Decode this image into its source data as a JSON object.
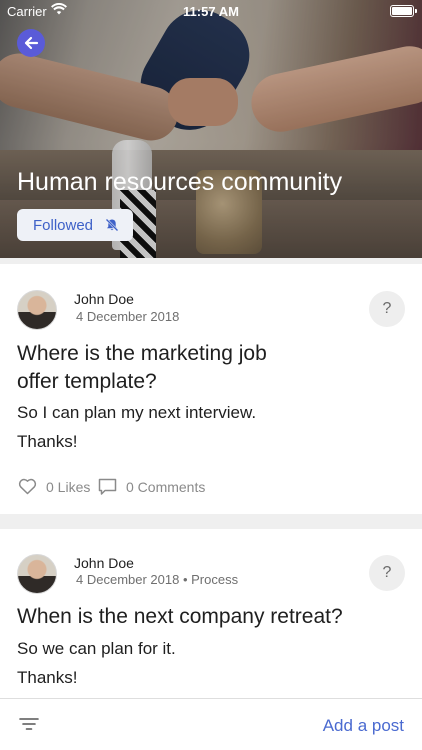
{
  "status_bar": {
    "carrier": "Carrier",
    "time": "11:57 AM"
  },
  "header": {
    "title": "Human resources community",
    "follow_label": "Followed",
    "icons": {
      "back": "arrow-left-icon",
      "bell": "bell-off-icon"
    },
    "accent_color": "#5a5bd8"
  },
  "posts": [
    {
      "author": "John Doe",
      "meta": "4 December 2018",
      "question_badge": "?",
      "title_line1": "Where is the marketing job",
      "title_line2": "offer template?",
      "body_line1": "So I can plan my next interview.",
      "body_line2": "Thanks!",
      "likes": "0 Likes",
      "comments": "0 Comments"
    },
    {
      "author": "John Doe",
      "meta": "4 December 2018 • Process",
      "question_badge": "?",
      "title_line1": "When is the next company retreat?",
      "body_line1": "So we can plan for it.",
      "body_line2": "Thanks!"
    }
  ],
  "bottom_bar": {
    "add_post_label": "Add a post",
    "link_color": "#4a6ad0"
  }
}
